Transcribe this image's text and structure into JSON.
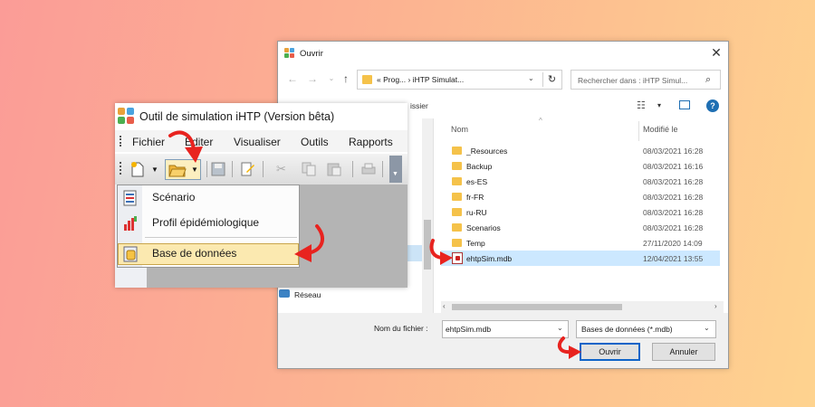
{
  "dialog": {
    "title": "Ouvrir",
    "close_label": "✕",
    "address": "« Prog... › iHTP Simulat...",
    "search_placeholder": "Rechercher dans : iHTP Simul...",
    "toolbar_fragment": "issier",
    "columns": {
      "name": "Nom",
      "modified": "Modifié le"
    },
    "files": [
      {
        "name": "_Resources",
        "date": "08/03/2021 16:28",
        "type": "folder"
      },
      {
        "name": "Backup",
        "date": "08/03/2021 16:16",
        "type": "folder"
      },
      {
        "name": "es-ES",
        "date": "08/03/2021 16:28",
        "type": "folder"
      },
      {
        "name": "fr-FR",
        "date": "08/03/2021 16:28",
        "type": "folder"
      },
      {
        "name": "ru-RU",
        "date": "08/03/2021 16:28",
        "type": "folder"
      },
      {
        "name": "Scenarios",
        "date": "08/03/2021 16:28",
        "type": "folder"
      },
      {
        "name": "Temp",
        "date": "27/11/2020 14:09",
        "type": "folder"
      },
      {
        "name": "ehtpSim.mdb",
        "date": "12/04/2021 13:55",
        "type": "mdb",
        "selected": true
      }
    ],
    "nav_pane_item": "Réseau",
    "filename_label": "Nom du fichier :",
    "filename_value": "ehtpSim.mdb",
    "filetype_value": "Bases de données (*.mdb)",
    "open_label": "Ouvrir",
    "cancel_label": "Annuler"
  },
  "app": {
    "title": "Outil de simulation iHTP (Version bêta)",
    "menu": [
      "Fichier",
      "Éditer",
      "Visualiser",
      "Outils",
      "Rapports"
    ],
    "dropdown": [
      "Scénario",
      "Profil épidémiologique",
      "Base de données"
    ],
    "highlighted_item": "Base de données"
  },
  "colors": {
    "accent_red": "#e8231f",
    "selection_blue": "#cce8ff",
    "highlight_yellow": "#fbe9b0"
  },
  "icons": [
    "app-logo-icon",
    "folder-icon",
    "database-file-icon",
    "network-icon",
    "open-folder-icon",
    "new-document-icon",
    "save-icon",
    "search-icon",
    "refresh-icon",
    "help-icon"
  ]
}
